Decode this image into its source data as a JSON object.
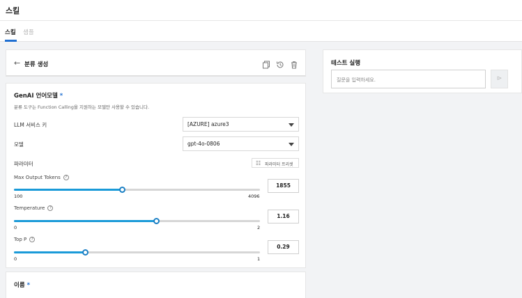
{
  "header": {
    "title": "스킬"
  },
  "tabs": [
    {
      "label": "스킬"
    },
    {
      "label": "샘플"
    }
  ],
  "panel": {
    "title": "분류 생성",
    "back_icon": "arrow-left-icon",
    "toolbar_icons": [
      "copy-icon",
      "history-icon",
      "trash-icon"
    ]
  },
  "model_section": {
    "title": "GenAI 언어모델",
    "required_mark": "*",
    "description": "분류 도구는 Function Calling을 지원하는 모델만 사용할 수 있습니다.",
    "llm_label": "LLM 서비스 키",
    "llm_value": "[AZURE] azure3",
    "model_label": "모델",
    "model_value": "gpt-4o-0806",
    "params_label": "파라미터",
    "preset_button": "파라미터 프리셋",
    "params": [
      {
        "label": "Max Output Tokens",
        "min": "100",
        "max": "4096",
        "value": "1855",
        "fraction": 0.44
      },
      {
        "label": "Temperature",
        "min": "0",
        "max": "2",
        "value": "1.16",
        "fraction": 0.58
      },
      {
        "label": "Top P",
        "min": "0",
        "max": "1",
        "value": "0.29",
        "fraction": 0.29
      }
    ]
  },
  "name_section": {
    "title": "이름",
    "required_mark": "*"
  },
  "test": {
    "title": "테스트 실행",
    "placeholder": "질문을 입력하세요.",
    "send_icon": "send-icon"
  },
  "colors": {
    "accent": "#1f6fd1",
    "slider": "#1a9ad8"
  }
}
